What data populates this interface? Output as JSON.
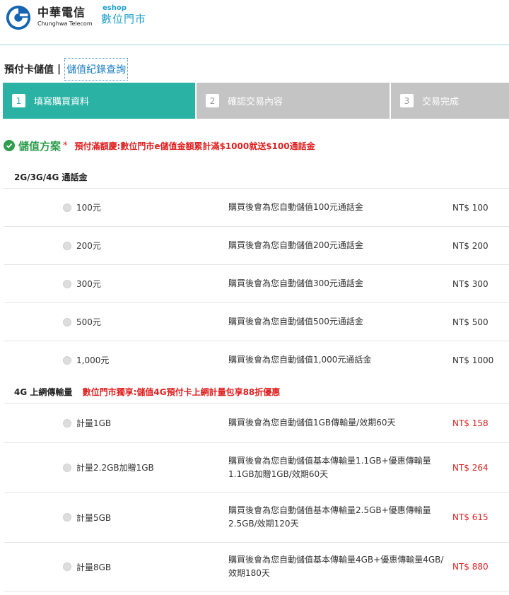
{
  "header": {
    "brand_cn": "中華電信",
    "brand_en": "Chunghwa Telecom",
    "eshop_en": "eshop",
    "eshop_cn": "數位門市"
  },
  "title": {
    "main": "預付卡儲值",
    "separator": "|",
    "link": "儲值紀錄查詢"
  },
  "steps": [
    {
      "num": "1",
      "label": "填寫購買資料"
    },
    {
      "num": "2",
      "label": "確認交易內容"
    },
    {
      "num": "3",
      "label": "交易完成"
    }
  ],
  "plan": {
    "title": "儲值方案",
    "required_mark": "*",
    "promo": "預付滿額慶:數位門市e儲值金額累計滿$1000就送$100通話金"
  },
  "sections": [
    {
      "label": "2G/3G/4G 通話金",
      "promo": "",
      "items": [
        {
          "option": "100元",
          "desc": "購買後會為您自動儲值100元通話金",
          "price": "NT$ 100"
        },
        {
          "option": "200元",
          "desc": "購買後會為您自動儲值200元通話金",
          "price": "NT$ 200"
        },
        {
          "option": "300元",
          "desc": "購買後會為您自動儲值300元通話金",
          "price": "NT$ 300"
        },
        {
          "option": "500元",
          "desc": "購買後會為您自動儲值500元通話金",
          "price": "NT$ 500"
        },
        {
          "option": "1,000元",
          "desc": "購買後會為您自動儲值1,000元通話金",
          "price": "NT$ 1000"
        }
      ]
    },
    {
      "label": "4G 上網傳輸量",
      "promo": "數位門市獨享:儲值4G預付卡上網計量包享88折優惠",
      "items": [
        {
          "option": "計量1GB",
          "desc": "購買後會為您自動儲值1GB傳輸量/效期60天",
          "price": "NT$ 158"
        },
        {
          "option": "計量2.2GB加贈1GB",
          "desc": "購買後會為您自動儲值基本傳輸量1.1GB+優惠傳輸量1.1GB加贈1GB/效期60天",
          "price": "NT$ 264"
        },
        {
          "option": "計量5GB",
          "desc": "購買後會為您自動儲值基本傳輸量2.5GB+優惠傳輸量2.5GB/效期120天",
          "price": "NT$ 615"
        },
        {
          "option": "計量8GB",
          "desc": "購買後會為您自動儲值基本傳輸量4GB+優惠傳輸量4GB/效期180天",
          "price": "NT$ 880"
        }
      ]
    }
  ],
  "colors": {
    "accent": "#2ab3a4",
    "inactive_step": "#c4c4c4",
    "plan_green": "#2e9d4d",
    "promo_red": "#e02020",
    "link_blue": "#1f7fc4"
  }
}
